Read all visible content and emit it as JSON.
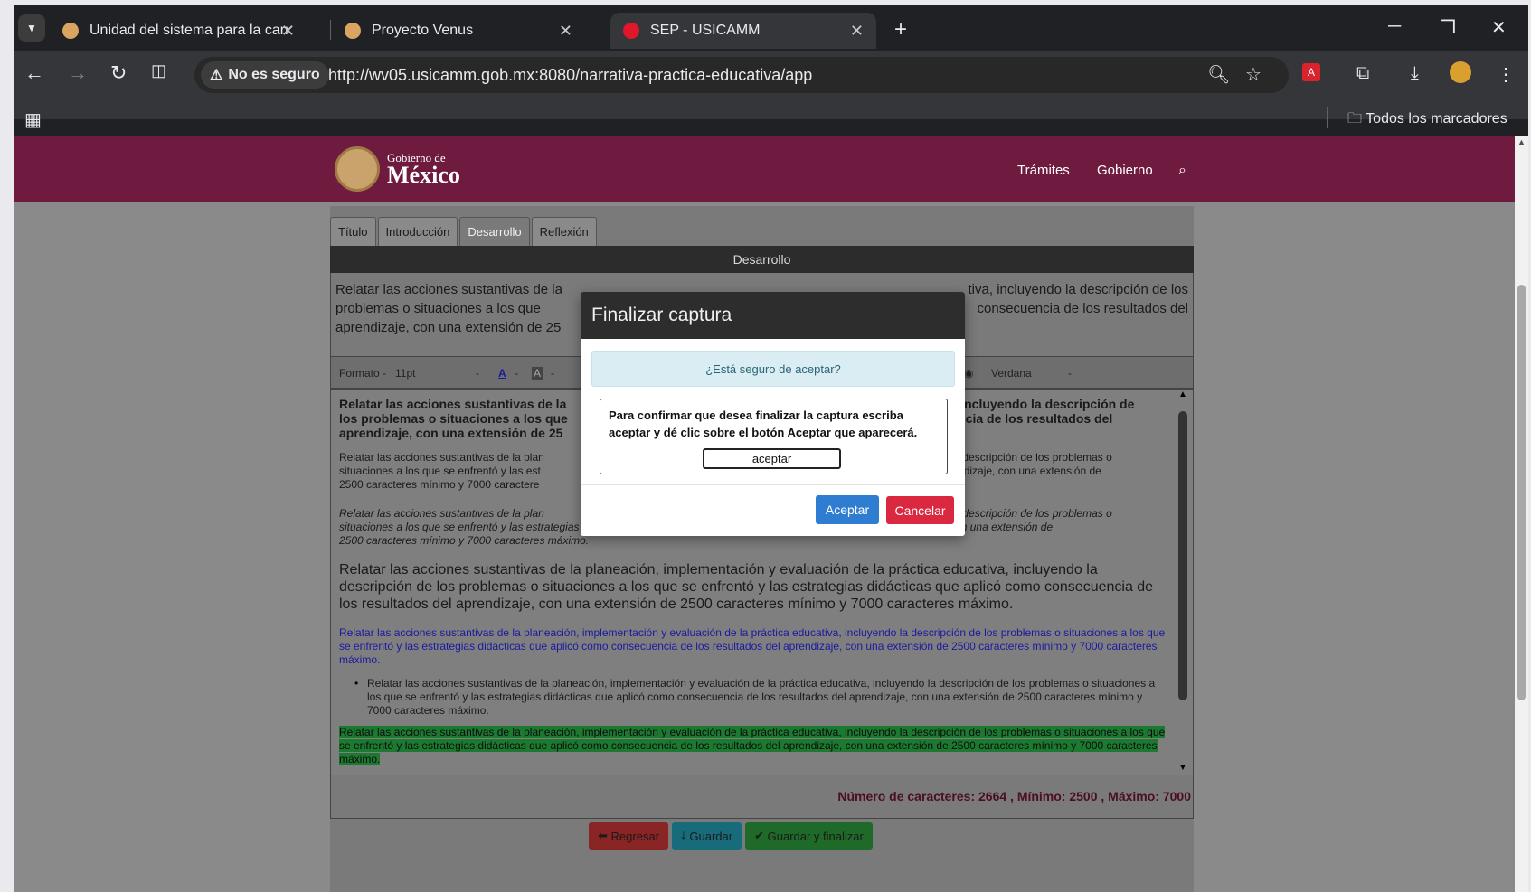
{
  "browser": {
    "tabs": [
      {
        "title": "Unidad del sistema para la carrera",
        "favicon_color": "#d9a560",
        "active": false
      },
      {
        "title": "Proyecto Venus",
        "favicon_color": "#d9a560",
        "active": false
      },
      {
        "title": "SEP - USICAMM",
        "favicon_color": "#e0162b",
        "active": true
      }
    ],
    "security_label": "No es seguro",
    "url": "http://wv05.usicamm.gob.mx:8080/narrativa-practica-educativa/app",
    "bookmarks_label": "Todos los marcadores"
  },
  "site": {
    "logo_small": "Gobierno de",
    "logo_big": "México",
    "nav": [
      "Trámites",
      "Gobierno"
    ],
    "brand_color": "#6f1a3f"
  },
  "form": {
    "tabs": [
      "Título",
      "Introducción",
      "Desarrollo",
      "Reflexión"
    ],
    "active_tab": "Desarrollo",
    "section_title": "Desarrollo",
    "description_fragments": {
      "left_1": "Relatar las acciones sustantivas de la",
      "right_1": "tiva, incluyendo la descripción de los",
      "left_2": "problemas o situaciones a los que",
      "right_2": "consecuencia de los resultados del",
      "left_3": "aprendizaje, con una extensión de 25"
    },
    "toolbar": {
      "format_label": "Formato",
      "font_size": "11pt",
      "font_family": "Verdana"
    },
    "editor": {
      "bold_left": "Relatar las acciones sustantivas de la",
      "bold_left_2": "los problemas o situaciones a los que",
      "bold_left_3": "aprendizaje, con una extensión de 25",
      "bold_right": "iva, incluyendo la descripción de",
      "bold_right_2": "cuencia de los resultados del",
      "small_left_1": "Relatar las acciones sustantivas de la plan",
      "small_left_2": "situaciones a los que se enfrentó y las est",
      "small_left_3": "2500 caracteres mínimo y 7000 caractere",
      "small_right_1": "do la descripción de los problemas o",
      "small_right_2": "aprendizaje, con una extensión de",
      "italic_left": "Relatar las acciones sustantivas de la plan",
      "italic_right": "do la descripción de los problemas o",
      "italic_2": "situaciones a los que se enfrentó y las estrategias didácticas que aplicó como consecuencia de los resultados del aprendizaje, con una extensión de",
      "italic_3": "2500 caracteres mínimo y 7000 caracteres máximo.",
      "large": "Relatar las acciones sustantivas de la planeación, implementación y evaluación de la práctica educativa, incluyendo la descripción de los problemas o situaciones a los que se enfrentó y las estrategias didácticas que aplicó como consecuencia de los resultados del aprendizaje, con una extensión de 2500 caracteres mínimo y 7000 caracteres máximo.",
      "blue": "Relatar las acciones sustantivas de la planeación, implementación y evaluación de la práctica educativa, incluyendo la descripción de los problemas o situaciones a los que se enfrentó y las estrategias didácticas que aplicó como consecuencia de los resultados del aprendizaje, con una extensión de 2500 caracteres mínimo y 7000 caracteres máximo.",
      "bullet": "Relatar las acciones sustantivas de la planeación, implementación y evaluación de la práctica educativa, incluyendo la descripción de los problemas o situaciones a los que se enfrentó y las estrategias didácticas que aplicó como consecuencia de los resultados del aprendizaje, con una extensión de 2500 caracteres mínimo y 7000 caracteres máximo.",
      "highlighted": "Relatar las acciones sustantivas de la planeación, implementación y evaluación de la práctica educativa, incluyendo la descripción de los problemas o situaciones a los que se enfrentó y las estrategias didácticas que aplicó como consecuencia de los resultados del aprendizaje, con una extensión de 2500 caracteres mínimo y 7000 caracteres máximo."
    },
    "counts": "Número de caracteres: 2664 , Mínimo: 2500 , Máximo: 7000",
    "buttons": {
      "back": "Regresar",
      "save": "Guardar",
      "save_finish": "Guardar y finalizar"
    }
  },
  "modal": {
    "title": "Finalizar captura",
    "alert": "¿Está seguro de aceptar?",
    "instructions": "Para confirmar que desea finalizar la captura escriba aceptar y dé clic sobre el botón Aceptar que aparecerá.",
    "input_value": "aceptar",
    "ok_label": "Aceptar",
    "cancel_label": "Cancelar"
  }
}
